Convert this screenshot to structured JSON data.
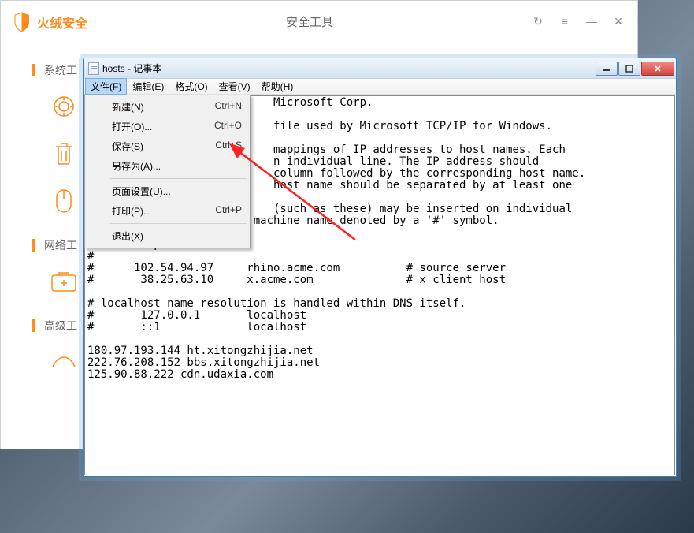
{
  "huorong": {
    "brand": "火绒安全",
    "title": "安全工具",
    "controls": {
      "refresh": "↻",
      "menu": "≡",
      "min": "—",
      "close": "✕"
    },
    "sections": {
      "system": "系统工",
      "network": "网络工",
      "advanced": "高级工"
    }
  },
  "notepad": {
    "title": "hosts - 记事本",
    "menubar": [
      {
        "label": "文件(F)"
      },
      {
        "label": "编辑(E)"
      },
      {
        "label": "格式(O)"
      },
      {
        "label": "查看(V)"
      },
      {
        "label": "帮助(H)"
      }
    ],
    "dropdown": [
      {
        "label": "新建(N)",
        "shortcut": "Ctrl+N"
      },
      {
        "label": "打开(O)...",
        "shortcut": "Ctrl+O"
      },
      {
        "label": "保存(S)",
        "shortcut": "Ctrl+S"
      },
      {
        "label": "另存为(A)...",
        "shortcut": ""
      },
      {
        "sep": true
      },
      {
        "label": "页面设置(U)...",
        "shortcut": ""
      },
      {
        "label": "打印(P)...",
        "shortcut": "Ctrl+P"
      },
      {
        "sep": true
      },
      {
        "label": "退出(X)",
        "shortcut": ""
      }
    ],
    "content": "                            Microsoft Corp.\n\n                            file used by Microsoft TCP/IP for Windows.\n\n                            mappings of IP addresses to host names. Each\n                            n individual line. The IP address should\n                            column followed by the corresponding host name.\n                            host name should be separated by at least one\n\n                            (such as these) may be inserted on individual\n# lines or following the machine name denoted by a '#' symbol.\n#\n# For example:\n#\n#      102.54.94.97     rhino.acme.com          # source server\n#       38.25.63.10     x.acme.com              # x client host\n\n# localhost name resolution is handled within DNS itself.\n#       127.0.0.1       localhost\n#       ::1             localhost\n\n180.97.193.144 ht.xitongzhijia.net\n222.76.208.152 bbs.xitongzhijia.net\n125.90.88.222 cdn.udaxia.com"
  }
}
